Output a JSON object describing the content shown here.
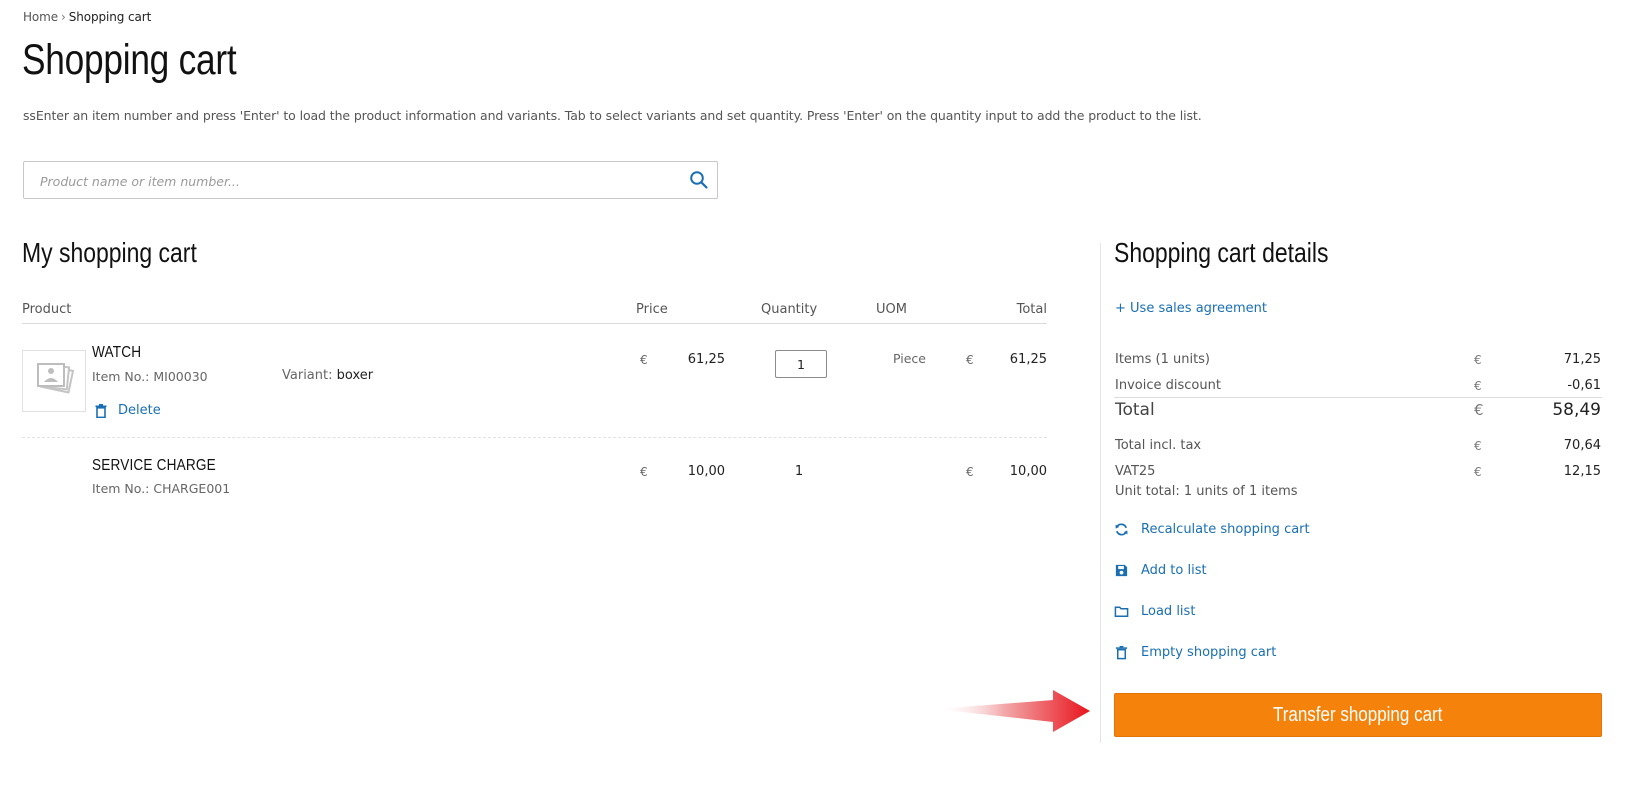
{
  "breadcrumb": {
    "home": "Home",
    "separator": "›",
    "current": "Shopping cart"
  },
  "page": {
    "title": "Shopping cart",
    "instructions": "ssEnter an item number and press 'Enter' to load the product information and variants. Tab to select variants and set quantity. Press 'Enter' on the quantity input to add the product to the list."
  },
  "search": {
    "placeholder": "Product name or item number...",
    "value": "",
    "icon": "search-icon"
  },
  "cart": {
    "title": "My shopping cart",
    "columns": {
      "product": "Product",
      "price": "Price",
      "quantity": "Quantity",
      "uom": "UOM",
      "total": "Total"
    },
    "items": [
      {
        "name": "WATCH",
        "item_no": "Item No.: MI00030",
        "variant_label": "Variant:",
        "variant_value": "boxer",
        "currency": "€",
        "price": "61,25",
        "quantity": "1",
        "uom": "Piece",
        "total_currency": "€",
        "total": "61,25",
        "delete_label": "Delete"
      },
      {
        "name": "SERVICE CHARGE",
        "item_no": "Item No.: CHARGE001",
        "currency": "€",
        "price": "10,00",
        "quantity": "1",
        "total_currency": "€",
        "total": "10,00"
      }
    ]
  },
  "details": {
    "title": "Shopping cart details",
    "sales_agreement": "+ Use sales agreement",
    "rows": [
      {
        "label": "Items (1 units)",
        "currency": "€",
        "value": "71,25"
      },
      {
        "label": "Invoice discount",
        "currency": "€",
        "value": "-0,61"
      },
      {
        "label": "Total",
        "currency": "€",
        "value": "58,49"
      },
      {
        "label": "Total incl. tax",
        "currency": "€",
        "value": "70,64"
      },
      {
        "label": "VAT25",
        "currency": "€",
        "value": "12,15"
      }
    ],
    "unit_total": "Unit total: 1 units of 1 items",
    "actions": [
      {
        "label": "Recalculate shopping cart",
        "icon": "refresh-icon"
      },
      {
        "label": "Add to list",
        "icon": "save-icon"
      },
      {
        "label": "Load list",
        "icon": "folder-icon"
      },
      {
        "label": "Empty shopping cart",
        "icon": "trash-icon"
      }
    ],
    "transfer_button": "Transfer shopping cart"
  },
  "colors": {
    "link": "#1a6fb3",
    "accent": "#f5830b",
    "arrow": "#e8141c"
  }
}
